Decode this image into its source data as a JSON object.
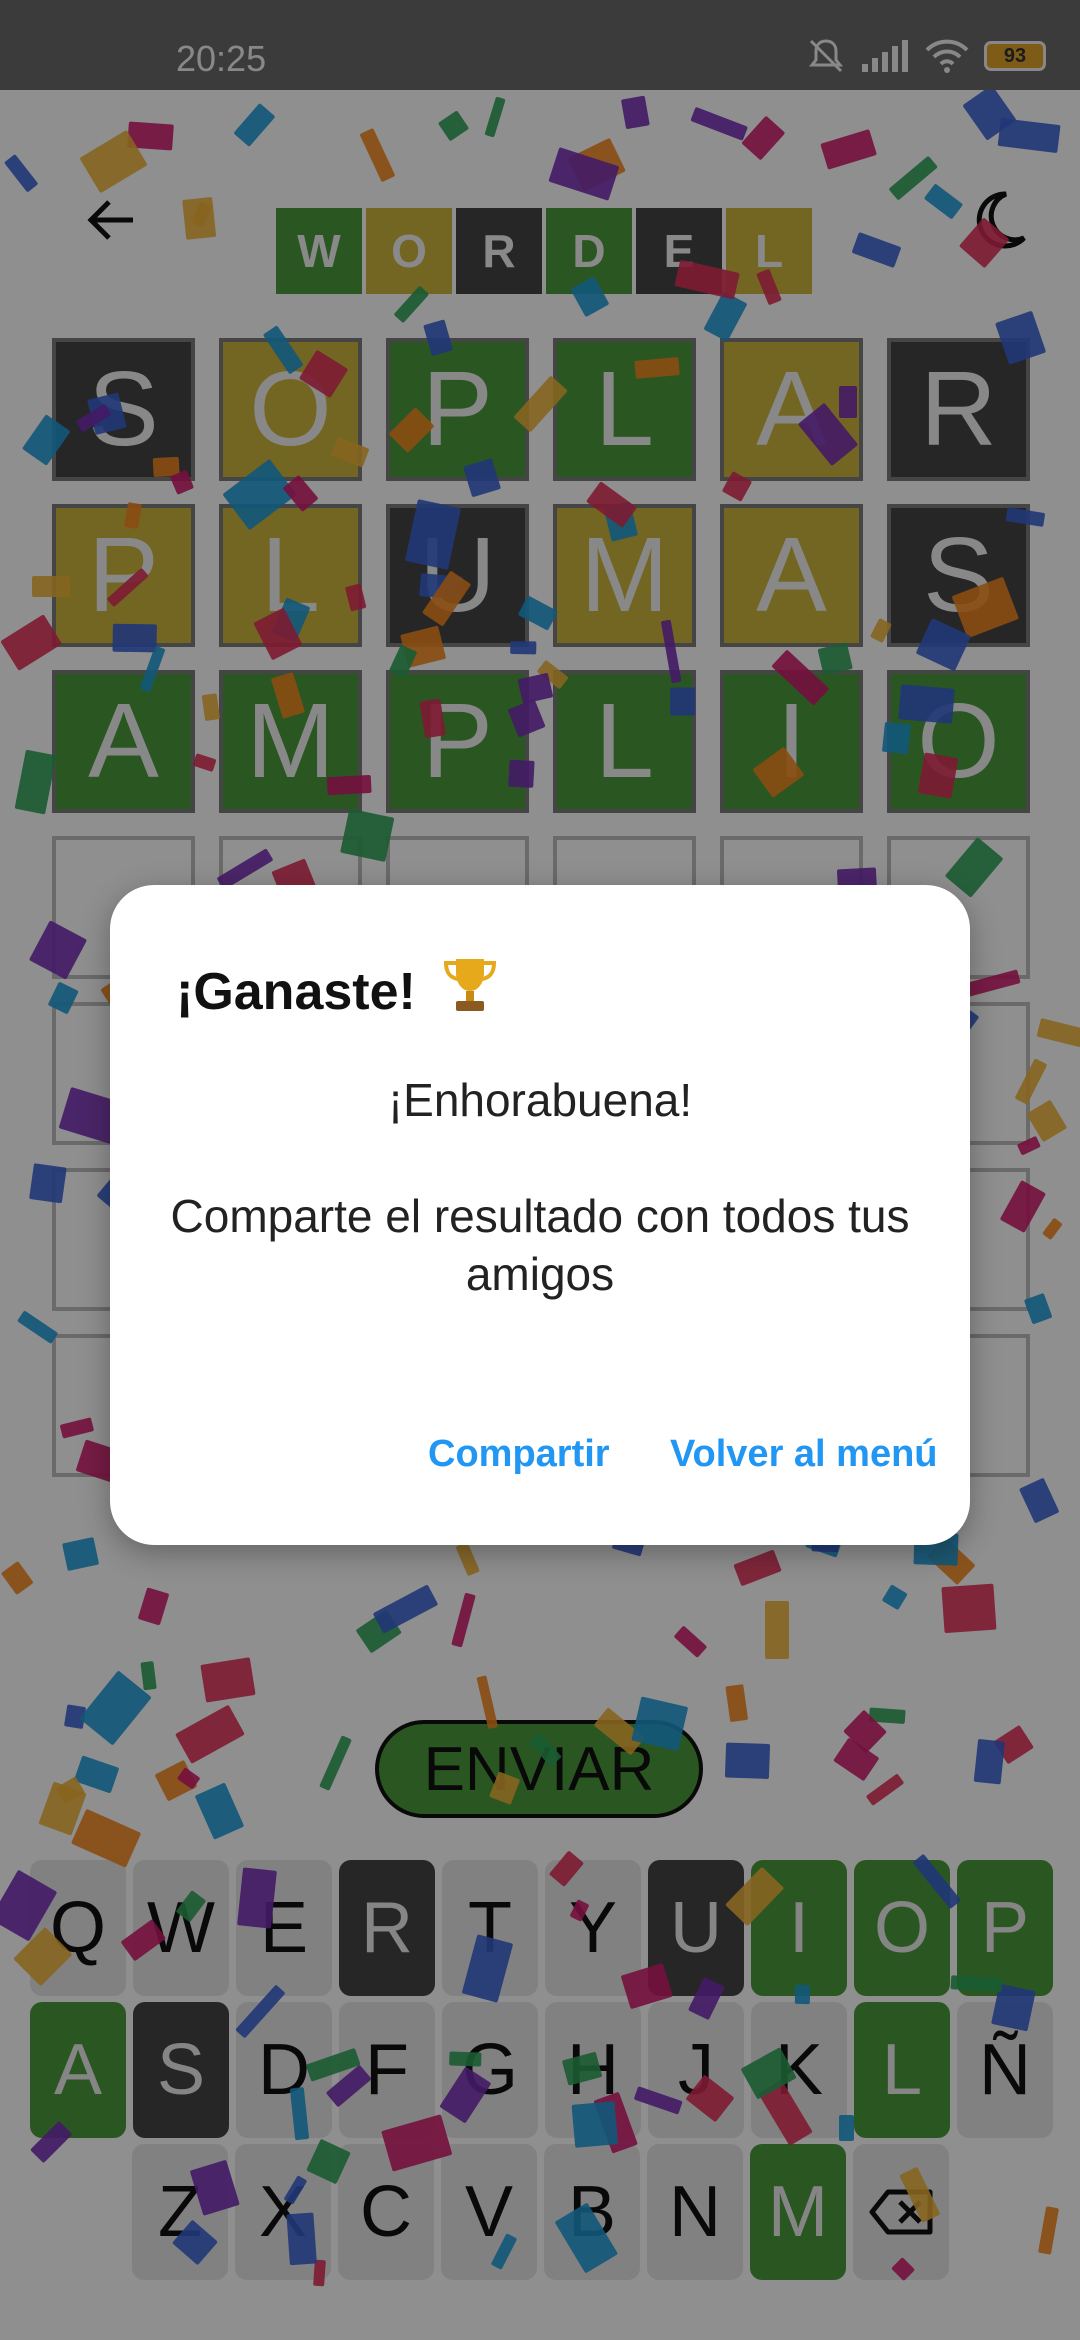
{
  "status_bar": {
    "time": "20:25",
    "battery_level": "93"
  },
  "header": {
    "logo_letters": [
      "W",
      "O",
      "R",
      "D",
      "E",
      "L"
    ],
    "logo_colors": [
      "green",
      "yellow",
      "gray",
      "green",
      "gray",
      "yellow"
    ]
  },
  "board": {
    "rows": [
      {
        "letters": [
          "S",
          "O",
          "P",
          "L",
          "A",
          "R"
        ],
        "states": [
          "gray",
          "yellow",
          "green",
          "green",
          "yellow",
          "gray"
        ]
      },
      {
        "letters": [
          "P",
          "L",
          "U",
          "M",
          "A",
          "S"
        ],
        "states": [
          "yellow",
          "yellow",
          "gray",
          "yellow",
          "yellow",
          "gray"
        ]
      },
      {
        "letters": [
          "A",
          "M",
          "P",
          "L",
          "I",
          "O"
        ],
        "states": [
          "green",
          "green",
          "green",
          "green",
          "green",
          "green"
        ]
      },
      {
        "letters": [
          "",
          "",
          "",
          "",
          "",
          ""
        ],
        "states": [
          "empty",
          "empty",
          "empty",
          "empty",
          "empty",
          "empty"
        ]
      },
      {
        "letters": [
          "",
          "",
          "",
          "",
          "",
          ""
        ],
        "states": [
          "empty",
          "empty",
          "empty",
          "empty",
          "empty",
          "empty"
        ]
      },
      {
        "letters": [
          "",
          "",
          "",
          "",
          "",
          ""
        ],
        "states": [
          "empty",
          "empty",
          "empty",
          "empty",
          "empty",
          "empty"
        ]
      },
      {
        "letters": [
          "",
          "",
          "",
          "",
          "",
          ""
        ],
        "states": [
          "empty",
          "empty",
          "empty",
          "empty",
          "empty",
          "empty"
        ]
      }
    ]
  },
  "submit_label": "ENVIAR",
  "keyboard": {
    "rows": [
      {
        "keys": [
          "Q",
          "W",
          "E",
          "R",
          "T",
          "Y",
          "U",
          "I",
          "O",
          "P"
        ],
        "states": [
          "default",
          "default",
          "default",
          "gray",
          "default",
          "default",
          "gray",
          "green",
          "green",
          "green"
        ]
      },
      {
        "keys": [
          "A",
          "S",
          "D",
          "F",
          "G",
          "H",
          "J",
          "K",
          "L",
          "Ñ"
        ],
        "states": [
          "green",
          "gray",
          "default",
          "default",
          "default",
          "default",
          "default",
          "default",
          "green",
          "default"
        ]
      },
      {
        "keys": [
          "Z",
          "X",
          "C",
          "V",
          "B",
          "N",
          "M"
        ],
        "states": [
          "default",
          "default",
          "default",
          "default",
          "default",
          "default",
          "green"
        ]
      }
    ],
    "backspace_icon": "backspace-icon"
  },
  "dialog": {
    "title": "¡Ganaste!",
    "title_icon": "trophy-icon",
    "message_1": "¡Enhorabuena!",
    "message_2": "Comparte el resultado con todos tus amigos",
    "share_label": "Compartir",
    "menu_label": "Volver al menú"
  },
  "colors": {
    "green": "#4b9b3c",
    "yellow": "#cdb43e",
    "gray": "#454545",
    "default_key": "#e7e7e7",
    "accent": "#2196f3"
  },
  "icons": {
    "back": "back-arrow-icon",
    "theme": "moon-icon"
  }
}
